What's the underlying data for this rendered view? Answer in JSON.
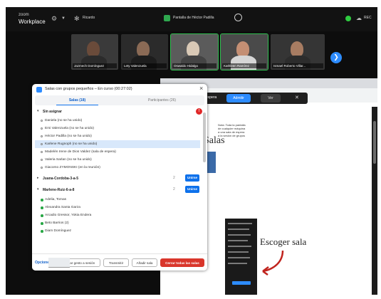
{
  "app": {
    "logo_line1": "zoom",
    "logo_line2": "Workplace",
    "topbar_item": "Ricardo",
    "share_title": "Pantalla de Héctor Padilla",
    "rec_label": "REC"
  },
  "participants": [
    {
      "name": "Jazmech Domínguez"
    },
    {
      "name": "Lety Valenzuela"
    },
    {
      "name": "Oswaldo Hidalgo"
    },
    {
      "name": "Kathleen Ramírez"
    },
    {
      "name": "Ismael Roberto Villar..."
    }
  ],
  "panel": {
    "title": "Salas con grupos pequeños – En curso (00:27:02)",
    "tabs": [
      {
        "label": "Salas (18)"
      },
      {
        "label": "Participantes (26)"
      }
    ],
    "unassigned": {
      "label": "Sin asignar",
      "badge": "!"
    },
    "unassigned_people": [
      "Daniela (no se ha unido)",
      "Emi Valenzuela (no se ha unido)",
      "Héctor Padilla (no se ha unido)",
      "Karlene Rugnoph (no se ha unido)",
      "Madelén Irene de Dios Valdez (sala de espera)",
      "Valeria Sarlan (no se ha unido)",
      "Giacomo ZYMONSKI (en la reunión)"
    ],
    "rooms": [
      {
        "name": "Juana-Cordoba-3-a-5",
        "count": "2",
        "join": "Unirse"
      },
      {
        "name": "Marlene-Ruiz-6-a-8",
        "count": "2",
        "join": "Unirse"
      }
    ],
    "room2_people": [
      "Adelia, Tomas",
      "Alexandra Santa Garza",
      "Arcadio Gressor, Yokia Endera",
      "Beto Barrios (2)",
      "Diam Domínguez"
    ],
    "footer": {
      "options": "Opciones",
      "buttons": [
        "Mandar gesto a sesión",
        "Transmitir",
        "Añadir sala"
      ],
      "close_all": "Cerrar todas las salas"
    }
  },
  "shared_screen": {
    "zoom_bar": {
      "left": "de espera",
      "admit": "Admitir",
      "view": "Ver"
    },
    "slide_title": "Salas",
    "slide_text": "Nota: Toda la pantalla de cualquier máquina a una sala de espera a la sesión de grupos",
    "escoger": "Escoger sala"
  },
  "colors": {
    "accent": "#0e71eb",
    "danger": "#d9362b",
    "live_green": "#2fbf4f"
  }
}
